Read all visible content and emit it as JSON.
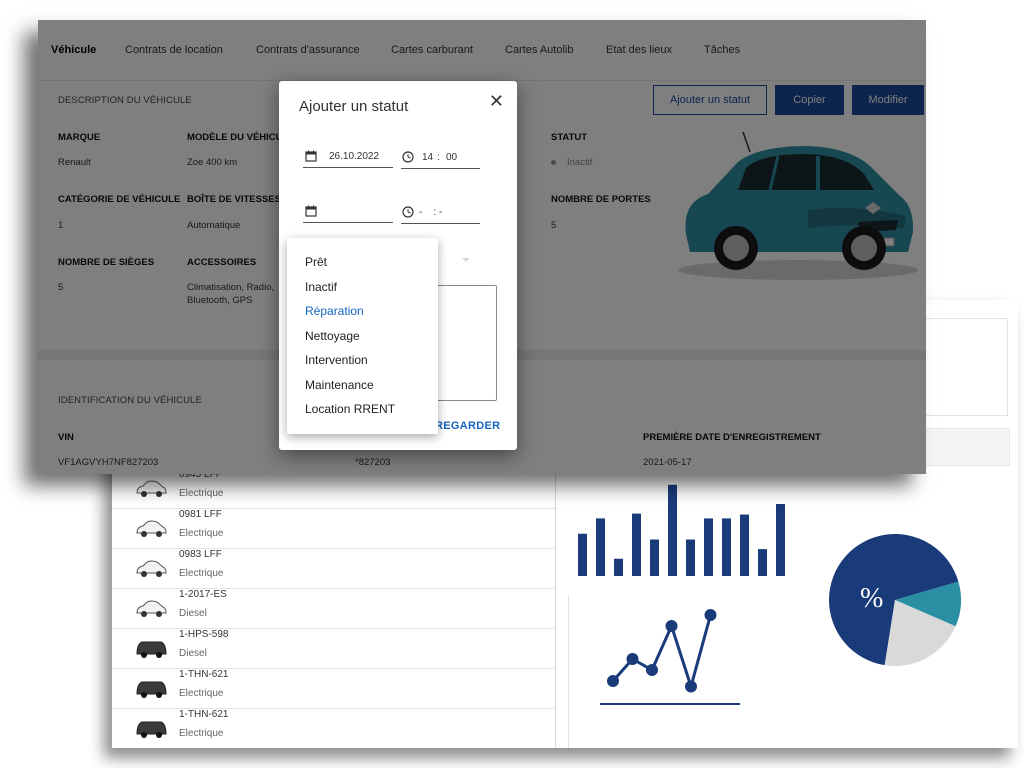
{
  "back": {
    "vehicles": [
      {
        "plate": "0945 LFF",
        "fuel": "Electrique",
        "color": "#f2f2f2"
      },
      {
        "plate": "0981 LFF",
        "fuel": "Electrique",
        "color": "#f2f2f2"
      },
      {
        "plate": "0983 LFF",
        "fuel": "Electrique",
        "color": "#f2f2f2"
      },
      {
        "plate": "1-2017-ES",
        "fuel": "Diesel",
        "color": "#f2f2f2"
      },
      {
        "plate": "1-HPS-598",
        "fuel": "Diesel",
        "color": "#3a3a3a"
      },
      {
        "plate": "1-THN-621",
        "fuel": "Electrique",
        "color": "#3a3a3a"
      },
      {
        "plate": "1-THN-621",
        "fuel": "Electrique",
        "color": "#3a3a3a"
      }
    ],
    "pie_label": "%"
  },
  "chart_data": [
    {
      "type": "bar",
      "values": [
        44,
        60,
        18,
        65,
        38,
        95,
        38,
        60,
        60,
        64,
        28,
        75
      ],
      "color": "#1a3b7a"
    },
    {
      "type": "line",
      "values": [
        1,
        3,
        2,
        6,
        0.5,
        7
      ],
      "color": "#1a3b7a"
    },
    {
      "type": "pie",
      "slices": [
        68,
        11,
        21
      ],
      "colors": [
        "#1a3b7a",
        "#2a8fa3",
        "#d9d9d9"
      ]
    }
  ],
  "front": {
    "tabs": [
      "Véhicule",
      "Contrats de location",
      "Contrats d'assurance",
      "Cartes carburant",
      "Cartes Autolib",
      "Etat des lieux",
      "Tâches"
    ],
    "description_title": "DESCRIPTION DU VÉHICULE",
    "buttons": {
      "add_status": "Ajouter un statut",
      "copy": "Copier",
      "edit": "Modifier"
    },
    "fields": {
      "marque_label": "MARQUE",
      "marque": "Renault",
      "modele_label": "MODÈLE DU VÉHICULE",
      "modele": "Zoe 400 km",
      "statut_label": "STATUT",
      "statut": "Inactif",
      "categorie_label": "CATÉGORIE DE VÉHICULE",
      "categorie": "1",
      "boite_label": "BOÎTE DE VITESSES",
      "boite": "Automatique",
      "portes_label": "NOMBRE DE PORTES",
      "portes": "5",
      "sieges_label": "NOMBRE DE SIÈGES",
      "sieges": "5",
      "accessoires_label": "ACCESSOIRES",
      "accessoires_1": "Climatisation, Radio,",
      "accessoires_2": "Bluetooth, GPS"
    },
    "identification_title": "IDENTIFICATION DU VÉHICULE",
    "vin_label": "VIN",
    "vin": "VF1AGVYH7NF827203",
    "vin_short": "*827203",
    "first_reg_label": "PREMIÈRE DATE D'ENREGISTREMENT",
    "first_reg": "2021-05-17",
    "car_color": "#2f8ea0"
  },
  "modal": {
    "title": "Ajouter un statut",
    "close": "✕",
    "start_date": "26.10.2022",
    "start_hour": "14",
    "start_min": "00",
    "end_date": "",
    "end_time": "-    : -",
    "save": "REGARDER"
  },
  "dropdown": {
    "options": [
      "Prêt",
      "Inactif",
      "Réparation",
      "Nettoyage",
      "Intervention",
      "Maintenance",
      "Location RRENT"
    ],
    "selected": "Réparation"
  }
}
